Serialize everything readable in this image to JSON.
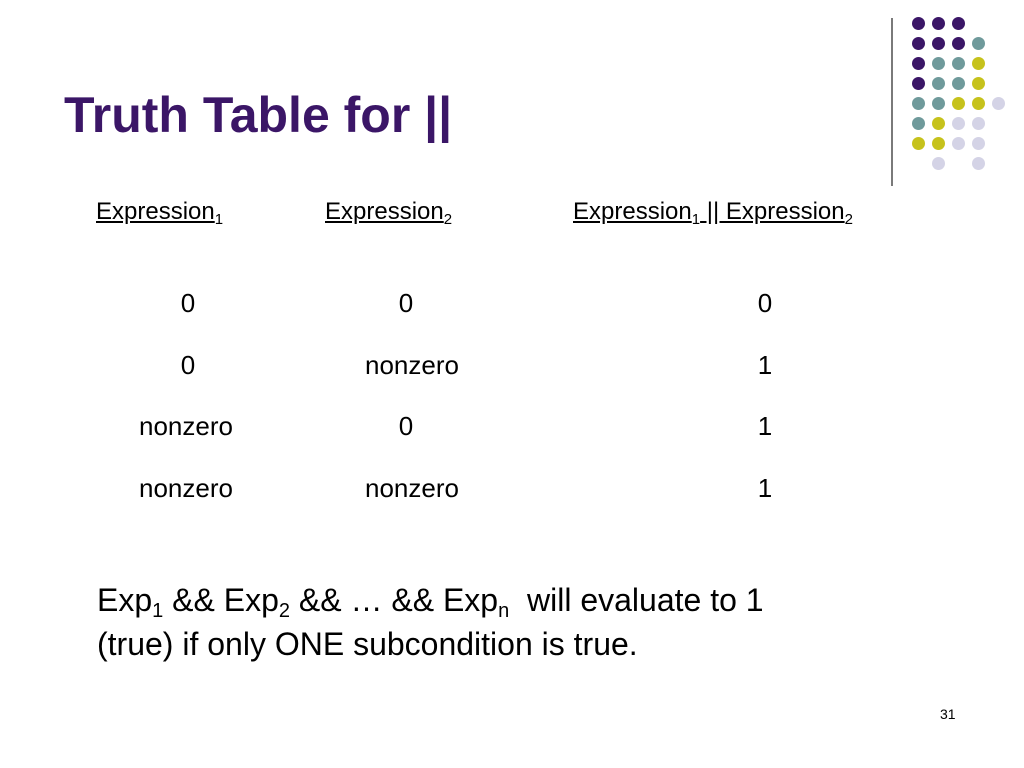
{
  "slide": {
    "title": "Truth Table for ||",
    "page_number": "31"
  },
  "table": {
    "headers": [
      {
        "base": "Expression",
        "sub": "1"
      },
      {
        "base": "Expression",
        "sub": "2"
      },
      {
        "base": "Expression",
        "sub": "1",
        "mid": " || Expression",
        "sub2": "2"
      }
    ],
    "rows": [
      [
        "0",
        "0",
        "0"
      ],
      [
        "0",
        "nonzero",
        "1"
      ],
      [
        "nonzero",
        "0",
        "1"
      ],
      [
        "nonzero",
        "nonzero",
        "1"
      ]
    ]
  },
  "summary": {
    "exp": "Exp",
    "sub1": "1",
    "op1": " && ",
    "sub2": "2",
    "op2": " && … && ",
    "subn": "n",
    "tail": "  will evaluate to 1",
    "line2": "(true) if only ONE subcondition is true."
  },
  "decoration": {
    "colors": {
      "purple": "#3b1667",
      "teal": "#6f9a9b",
      "lime": "#c6c21c",
      "lavender": "#d4d3e6"
    },
    "dot_grid": [
      [
        "purple",
        "purple",
        "purple",
        null
      ],
      [
        "purple",
        "purple",
        "purple",
        "teal"
      ],
      [
        "purple",
        "teal",
        "teal",
        "lime"
      ],
      [
        "purple",
        "teal",
        "teal",
        "lime"
      ],
      [
        "teal",
        "teal",
        "lime",
        "lime",
        "lavender"
      ],
      [
        "teal",
        "lime",
        "lavender",
        "lavender"
      ],
      [
        "lime",
        "lime",
        "lavender",
        "lavender"
      ],
      [
        null,
        "lavender",
        null,
        "lavender"
      ]
    ]
  }
}
